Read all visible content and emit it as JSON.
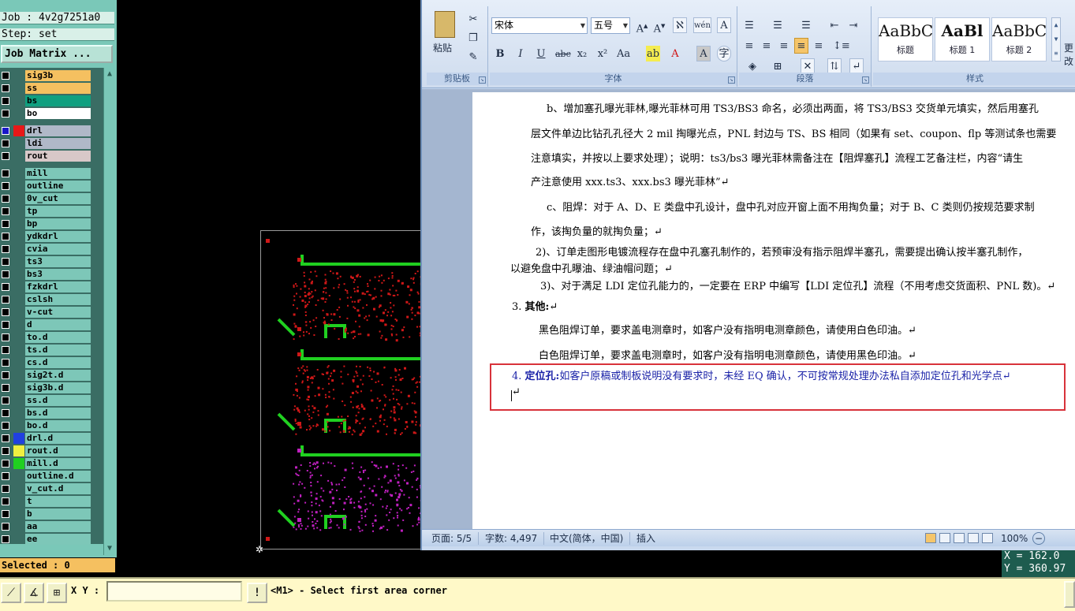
{
  "cam": {
    "job_line": "Job : 4v2g7251a0",
    "step_line": "Step: set",
    "job_matrix_label": "Job Matrix ...",
    "selected_status": "Selected : 0",
    "layers": [
      {
        "name": "sig3b",
        "label_color": "#f5c060",
        "swatch": "",
        "checked": false
      },
      {
        "name": "ss",
        "label_color": "#f5c060",
        "swatch": "",
        "checked": false
      },
      {
        "name": "bs",
        "label_color": "#10a080",
        "swatch": "",
        "checked": false
      },
      {
        "name": "bo",
        "label_color": "#ffffff",
        "swatch": "",
        "checked": false
      },
      {
        "name": "drl",
        "label_color": "#b0b8c8",
        "swatch": "#e81818",
        "checked": true
      },
      {
        "name": "ldi",
        "label_color": "#b0b8c8",
        "swatch": "",
        "checked": false
      },
      {
        "name": "rout",
        "label_color": "#d8c8c8",
        "swatch": "",
        "checked": false
      },
      {
        "name": "mill",
        "label_color": "#7dc7b8",
        "swatch": "",
        "checked": false
      },
      {
        "name": "outline",
        "label_color": "#7dc7b8",
        "swatch": "",
        "checked": false
      },
      {
        "name": "0v_cut",
        "label_color": "#7dc7b8",
        "swatch": "",
        "checked": false
      },
      {
        "name": "tp",
        "label_color": "#7dc7b8",
        "swatch": "",
        "checked": false
      },
      {
        "name": "bp",
        "label_color": "#7dc7b8",
        "swatch": "",
        "checked": false
      },
      {
        "name": "ydkdrl",
        "label_color": "#7dc7b8",
        "swatch": "",
        "checked": false
      },
      {
        "name": "cvia",
        "label_color": "#7dc7b8",
        "swatch": "",
        "checked": false
      },
      {
        "name": "ts3",
        "label_color": "#7dc7b8",
        "swatch": "",
        "checked": false
      },
      {
        "name": "bs3",
        "label_color": "#7dc7b8",
        "swatch": "",
        "checked": false
      },
      {
        "name": "fzkdrl",
        "label_color": "#7dc7b8",
        "swatch": "",
        "checked": false
      },
      {
        "name": "cslsh",
        "label_color": "#7dc7b8",
        "swatch": "",
        "checked": false
      },
      {
        "name": "v-cut",
        "label_color": "#7dc7b8",
        "swatch": "",
        "checked": false
      },
      {
        "name": "d",
        "label_color": "#7dc7b8",
        "swatch": "",
        "checked": false
      },
      {
        "name": "to.d",
        "label_color": "#7dc7b8",
        "swatch": "",
        "checked": false
      },
      {
        "name": "ts.d",
        "label_color": "#7dc7b8",
        "swatch": "",
        "checked": false
      },
      {
        "name": "cs.d",
        "label_color": "#7dc7b8",
        "swatch": "",
        "checked": false
      },
      {
        "name": "sig2t.d",
        "label_color": "#7dc7b8",
        "swatch": "",
        "checked": false
      },
      {
        "name": "sig3b.d",
        "label_color": "#7dc7b8",
        "swatch": "",
        "checked": false
      },
      {
        "name": "ss.d",
        "label_color": "#7dc7b8",
        "swatch": "",
        "checked": false
      },
      {
        "name": "bs.d",
        "label_color": "#7dc7b8",
        "swatch": "",
        "checked": false
      },
      {
        "name": "bo.d",
        "label_color": "#7dc7b8",
        "swatch": "",
        "checked": false
      },
      {
        "name": "drl.d",
        "label_color": "#7dc7b8",
        "swatch": "#2040e0",
        "checked": false
      },
      {
        "name": "rout.d",
        "label_color": "#7dc7b8",
        "swatch": "#f0f040",
        "checked": false
      },
      {
        "name": "mill.d",
        "label_color": "#7dc7b8",
        "swatch": "#20d020",
        "checked": false
      },
      {
        "name": "outline.d",
        "label_color": "#7dc7b8",
        "swatch": "",
        "checked": false
      },
      {
        "name": "v_cut.d",
        "label_color": "#7dc7b8",
        "swatch": "",
        "checked": false
      },
      {
        "name": "t",
        "label_color": "#7dc7b8",
        "swatch": "",
        "checked": false
      },
      {
        "name": "b",
        "label_color": "#7dc7b8",
        "swatch": "",
        "checked": false
      },
      {
        "name": "aa",
        "label_color": "#7dc7b8",
        "swatch": "",
        "checked": false
      },
      {
        "name": "ee",
        "label_color": "#7dc7b8",
        "swatch": "",
        "checked": false
      }
    ],
    "coords": {
      "x_line": "X = 162.0",
      "y_line": "Y = 360.97"
    },
    "bottom": {
      "xy_label": "X Y :",
      "xy_value": "",
      "alert_icon": "!",
      "message": "<M1> - Select first area corner"
    }
  },
  "word": {
    "clipboard": {
      "paste_label": "粘贴",
      "caption": "剪贴板"
    },
    "font": {
      "font_name": "宋体",
      "font_size": "五号",
      "caption": "字体",
      "row2": [
        "B",
        "I",
        "U",
        "abc",
        "x₂",
        "x²",
        "Aa"
      ]
    },
    "paragraph": {
      "caption": "段落"
    },
    "styles": {
      "caption": "样式",
      "tiles": [
        {
          "sample": "AaBbC",
          "name": "标题"
        },
        {
          "sample": "AaBl",
          "name": "标题 1"
        },
        {
          "sample": "AaBbC",
          "name": "标题 2"
        }
      ],
      "more_label": "更改"
    },
    "doc_lines": [
      "b、增加塞孔曝光菲林,曝光菲林可用 TS3/BS3 命名，必须出两面，将 TS3/BS3 交货单元填实，然后用塞孔",
      "层文件单边比钻孔孔径大 2 mil 掏曝光点，PNL 封边与 TS、BS 相同（如果有 set、coupon、flp 等测试条也需要",
      "注意填实，并按以上要求处理）；说明：ts3/bs3 曝光菲林需备注在【阻焊塞孔】流程工艺备注栏，内容“请生",
      "产注意使用 xxx.ts3、xxx.bs3 曝光菲林”↵",
      "c、阻焊：对于 A、D、E 类盘中孔设计，盘中孔对应开窗上面不用掏负量；对于 B、C 类则仍按规范要求制",
      "作，该掏负量的就掏负量；↵",
      "2)、订单走图形电镀流程存在盘中孔塞孔制作的，若预审没有指示阻焊半塞孔，需要提出确认按半塞孔制作，",
      "以避免盘中孔曝油、绿油帽问题；↵",
      "3)、对于满足 LDI 定位孔能力的，一定要在 ERP 中编写【LDI 定位孔】流程（不用考虑交货面积、PNL 数)。↵",
      "黑色阻焊订单，要求盖电测章时，如客户没有指明电测章颜色，请使用白色印油。↵",
      "白色阻焊订单，要求盖电测章时，如客户没有指明电测章颜色，请使用黑色印油。↵",
      "如客户原稿或制板说明没有要求时，未经 EQ 确认，不可按常规处理办法私自添加定位孔和光学点↵",
      "↵"
    ],
    "headings": {
      "h3_num": "3.",
      "h3_text": "其他:",
      "h3_mark": "↵",
      "h4_num": "4.",
      "h4_text": "定位孔:"
    },
    "status": {
      "page": "页面: 5/5",
      "words": "字数: 4,497",
      "language": "中文(简体，中国)",
      "mode": "插入",
      "zoom": "100%"
    }
  }
}
